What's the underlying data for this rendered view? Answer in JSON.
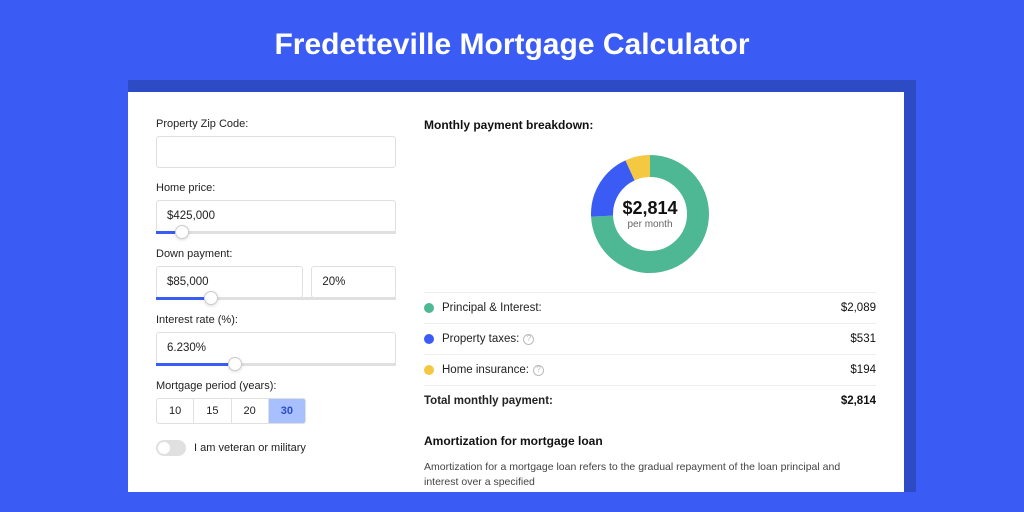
{
  "title": "Fredetteville Mortgage Calculator",
  "form": {
    "zip_label": "Property Zip Code:",
    "zip_value": "",
    "home_price_label": "Home price:",
    "home_price_value": "$425,000",
    "home_price_slider_pct": 8,
    "down_payment_label": "Down payment:",
    "down_payment_value": "$85,000",
    "down_payment_pct": "20%",
    "down_payment_slider_pct": 20,
    "interest_label": "Interest rate (%):",
    "interest_value": "6.230%",
    "interest_slider_pct": 30,
    "period_label": "Mortgage period (years):",
    "periods": [
      "10",
      "15",
      "20",
      "30"
    ],
    "period_active": "30",
    "veteran_label": "I am veteran or military"
  },
  "breakdown": {
    "title": "Monthly payment breakdown:",
    "total": "$2,814",
    "total_sub": "per month",
    "items": [
      {
        "label": "Principal & Interest:",
        "value": "$2,089",
        "color": "green"
      },
      {
        "label": "Property taxes:",
        "value": "$531",
        "color": "blue",
        "info": true
      },
      {
        "label": "Home insurance:",
        "value": "$194",
        "color": "yellow",
        "info": true
      }
    ],
    "total_label": "Total monthly payment:",
    "total_value": "$2,814"
  },
  "chart_data": {
    "type": "pie",
    "title": "Monthly payment breakdown",
    "series": [
      {
        "name": "Principal & Interest",
        "value": 2089,
        "color": "#4eb794"
      },
      {
        "name": "Property taxes",
        "value": 531,
        "color": "#3a5cf5"
      },
      {
        "name": "Home insurance",
        "value": 194,
        "color": "#f5c842"
      }
    ],
    "total": 2814
  },
  "amortization": {
    "title": "Amortization for mortgage loan",
    "text": "Amortization for a mortgage loan refers to the gradual repayment of the loan principal and interest over a specified"
  }
}
